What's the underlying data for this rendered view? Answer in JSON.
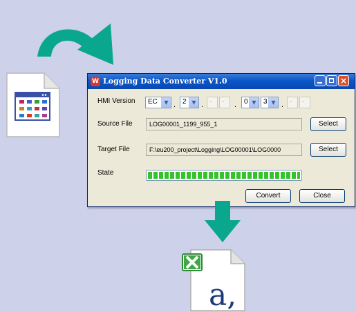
{
  "window": {
    "title": "Logging Data Converter V1.0",
    "app_icon_text": "W"
  },
  "form": {
    "hmi_version_label": "HMI Version",
    "source_file_label": "Source File",
    "target_file_label": "Target File",
    "state_label": "State",
    "version_fields": [
      {
        "value": "EC",
        "enabled": true
      },
      {
        "value": "2",
        "enabled": true
      },
      {
        "value": "-",
        "enabled": false
      },
      {
        "value": "-",
        "enabled": false
      },
      {
        "value": "0",
        "enabled": true
      },
      {
        "value": "3",
        "enabled": true
      },
      {
        "value": "-",
        "enabled": false
      },
      {
        "value": "-",
        "enabled": false
      }
    ],
    "source_file_value": "LOG00001_1199_955_1",
    "target_file_value": "F:\\eu200_project\\Logging\\LOG00001\\LOG0000",
    "select_label": "Select",
    "convert_label": "Convert",
    "close_label": "Close",
    "progress_fraction": 1.0
  },
  "excel_icon_text": "a,",
  "colors": {
    "background": "#cdd1ea",
    "arrow": "#0aa78e",
    "titlebar": "#0a57c9",
    "progress": "#37c22c"
  }
}
